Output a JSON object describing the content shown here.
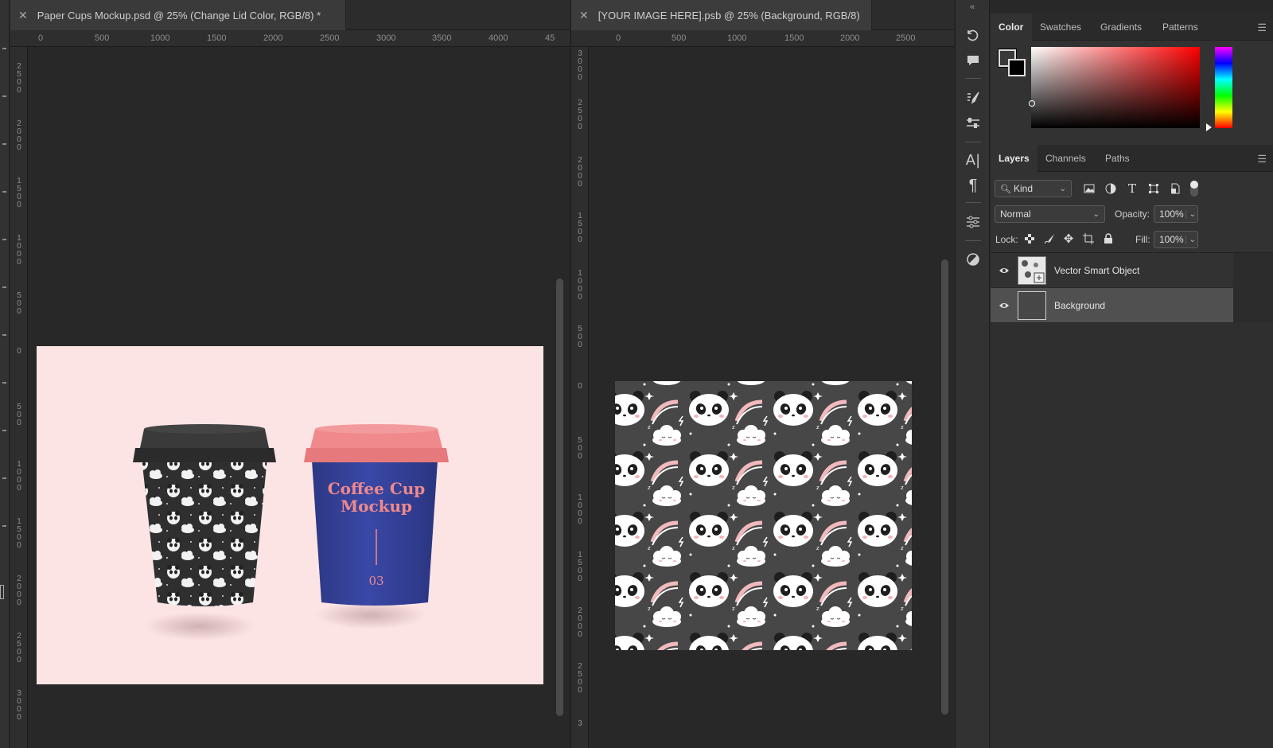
{
  "left_doc": {
    "tab_title": "Paper Cups Mockup.psd @ 25% (Change Lid Color, RGB/8) *",
    "ruler_h": [
      "0",
      "500",
      "1000",
      "1500",
      "2000",
      "2500",
      "3000",
      "3500",
      "4000",
      "45"
    ],
    "ruler_v": [
      "2500",
      "2000",
      "1500",
      "1000",
      "500",
      "0",
      "500",
      "1000",
      "1500",
      "2000",
      "2500",
      "3000"
    ],
    "cup2_text_line1": "Coffee Cup",
    "cup2_text_line2": "Mockup",
    "cup2_number": "03"
  },
  "right_doc": {
    "tab_title": "[YOUR IMAGE HERE].psb @ 25% (Background, RGB/8)",
    "ruler_h": [
      "0",
      "500",
      "1000",
      "1500",
      "2000",
      "2500"
    ],
    "ruler_v": [
      "3000",
      "2500",
      "2000",
      "1500",
      "1000",
      "500",
      "0",
      "500",
      "1000",
      "1500",
      "2000",
      "2500",
      "3"
    ]
  },
  "color_panel": {
    "tabs": [
      "Color",
      "Swatches",
      "Gradients",
      "Patterns"
    ],
    "active_tab": "Color"
  },
  "layers_panel": {
    "tabs": [
      "Layers",
      "Channels",
      "Paths"
    ],
    "active_tab": "Layers",
    "filter_kind": "Kind",
    "blend_mode": "Normal",
    "opacity_label": "Opacity:",
    "opacity_value": "100%",
    "lock_label": "Lock:",
    "fill_label": "Fill:",
    "fill_value": "100%",
    "layers": [
      {
        "name": "Vector Smart Object",
        "selected": false
      },
      {
        "name": "Background",
        "selected": true
      }
    ]
  },
  "colors": {
    "mockup_bg": "#fde4e4",
    "cup_blue": "#34429a",
    "lid_pink": "#f0898c",
    "lid_black": "#2b2b2b",
    "pattern_bg": "#474747"
  },
  "icon_names": [
    "history-icon",
    "comment-icon",
    "brush-settings-icon",
    "tool-presets-icon",
    "character-icon",
    "paragraph-icon",
    "adjustments-icon",
    "properties-icon"
  ]
}
